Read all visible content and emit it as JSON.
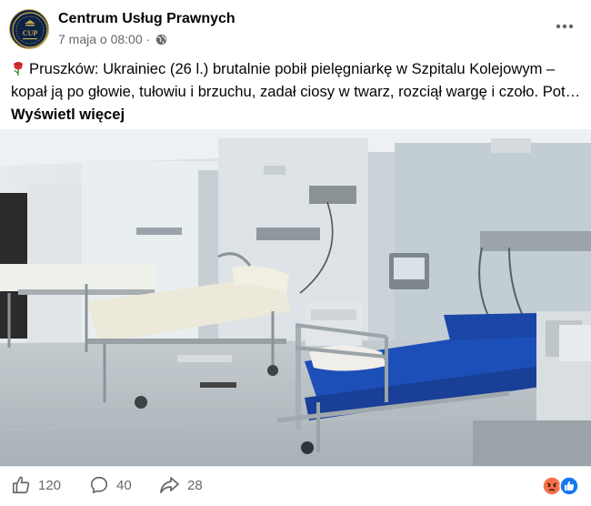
{
  "post": {
    "page_name": "Centrum Usług Prawnych",
    "date": "7 maja o 08:00",
    "separator": "·",
    "text": "Pruszków: Ukrainiec (26 l.) brutalnie pobił pielęgniarkę w Szpitalu Kolejowym – kopał ją po głowie, tułowiu i brzuchu, zadał ciosy w twarz, rozciął wargę i czoło. Pot…",
    "see_more": "Wyświetl więcej",
    "avatar_text": "CUP"
  },
  "stats": {
    "likes": "120",
    "comments": "40",
    "shares": "28"
  },
  "icons": {
    "privacy": "globe-icon",
    "more": "more-dots-icon",
    "like": "thumbs-up-icon",
    "comment": "comment-bubble-icon",
    "share": "share-arrow-icon",
    "reactions": [
      "angry-reaction-icon",
      "like-reaction-icon"
    ],
    "emoji": "rose-icon"
  },
  "colors": {
    "secondary_text": "#65676b",
    "like_blue": "#1877f2",
    "angry_orange": "#f7714b",
    "bed_blue": "#1d4fb8"
  }
}
